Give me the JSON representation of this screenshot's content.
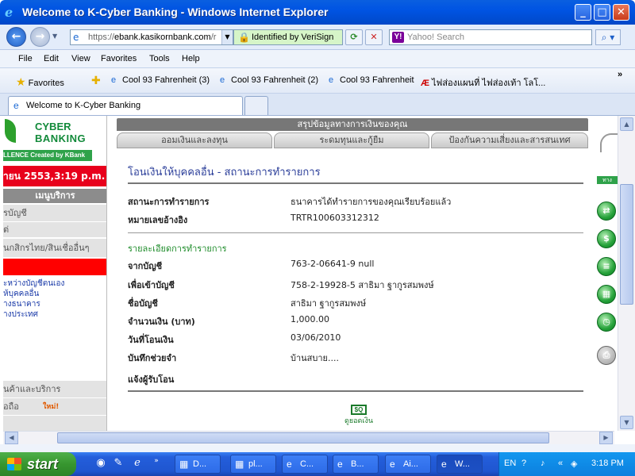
{
  "window": {
    "title": "Welcome to K-Cyber Banking - Windows Internet Explorer",
    "controls": {
      "minimize": "_",
      "maximize": "□",
      "close": "✕"
    }
  },
  "address": {
    "url_prefix": "https://",
    "url_domain": "ebank.kasikornbank.com",
    "url_rest": "/r",
    "identity": "Identified by VeriSign",
    "search_placeholder": "Yahoo! Search"
  },
  "menubar": [
    "File",
    "Edit",
    "View",
    "Favorites",
    "Tools",
    "Help"
  ],
  "favorites": {
    "label": "Favorites",
    "items": [
      "Cool 93 Fahrenheit (3)",
      "Cool 93 Fahrenheit (2)",
      "Cool 93 Fahrenheit",
      "ไฟส่องแผนที่ ไฟส่องเท้า โลโ..."
    ],
    "overflow": "»"
  },
  "tabs": {
    "active": "Welcome to K-Cyber Banking"
  },
  "sidebar": {
    "logo_line1": "CYBER",
    "logo_line2": "BANKING",
    "logo_strip": "LLENCE Created by KBank",
    "datetime": "ายน 2553,3:19 p.m.",
    "menu_header": "เมนูบริการ",
    "items": [
      "รบัญชี",
      "ต่",
      "นกสิกรไทย/สินเชื่ออื่นๆ"
    ],
    "links": [
      "ะหว่างบัญชีตนเอง",
      "ห้บุคคลอื่น",
      "างธนาคาร",
      "างประเทศ"
    ],
    "bottom_items": [
      "นค้าและบริการ",
      "อถือ"
    ],
    "new_badge": "ใหม่!"
  },
  "main": {
    "summary_title": "สรุปข้อมูลทางการเงินของคุณ",
    "tabs": [
      "ออมเงินและลงทุน",
      "ระดมทุนและกู้ยืม",
      "ป้องกันความเสี่ยงและสารสนเทศ"
    ],
    "page_title": "โอนเงินให้บุคคลอื่น - สถานะการทำรายการ",
    "status": {
      "label": "สถานะการทำรายการ",
      "value": "ธนาคารได้ทำรายการของคุณเรียบร้อยแล้ว"
    },
    "reference": {
      "label": "หมายเลขอ้างอิง",
      "value": "TRTR100603312312"
    },
    "details_header": "รายละเอียดการทำรายการ",
    "details": [
      {
        "label": "จากบัญชี",
        "value": "763-2-06641-9 null"
      },
      {
        "label": "เพื่อเข้าบัญชี",
        "value": "758-2-19928-5 สาธิมา ฐากูรสมพงษ์"
      },
      {
        "label": "ชื่อบัญชี",
        "value": "สาธิมา ฐากูรสมพงษ์"
      },
      {
        "label": "จำนวนเงิน (บาท)",
        "value": "1,000.00"
      },
      {
        "label": "วันที่โอนเงิน",
        "value": "03/06/2010"
      },
      {
        "label": "บันทึกช่วยจำ",
        "value": "บ้านสบาย...."
      },
      {
        "label": "แจ้งผู้รับโอน",
        "value": ""
      }
    ],
    "print_icon_text": "$Q",
    "print_label": "ดูยอดเงิน"
  },
  "rightcol": {
    "tab_label": "ทาง",
    "icons": [
      "transfer-icon",
      "money-icon",
      "document-icon",
      "calculator-icon",
      "clock-icon",
      "printer-icon"
    ]
  },
  "taskbar": {
    "start": "start",
    "buttons": [
      "D...",
      "pl...",
      "C...",
      "B...",
      "Ai...",
      "W..."
    ],
    "language": "EN",
    "clock": "3:18 PM"
  }
}
